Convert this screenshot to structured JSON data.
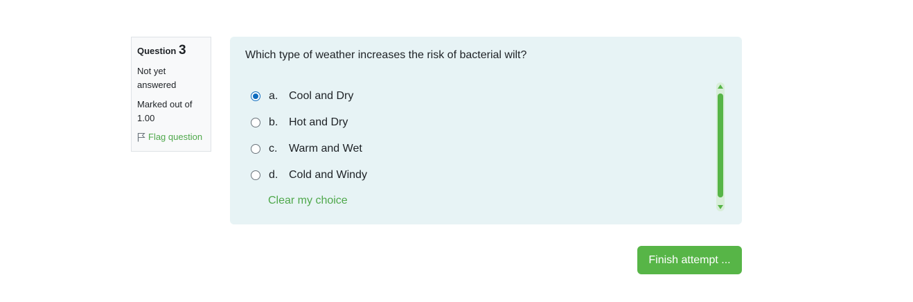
{
  "question_info": {
    "heading_label": "Question",
    "number": "3",
    "status": "Not yet answered",
    "marked_out_of": "Marked out of 1.00",
    "flag_label": "Flag question"
  },
  "question": {
    "text": "Which type of weather increases the risk of bacterial wilt?",
    "answers": [
      {
        "letter": "a.",
        "text": "Cool and Dry",
        "selected": true
      },
      {
        "letter": "b.",
        "text": "Hot and Dry",
        "selected": false
      },
      {
        "letter": "c.",
        "text": "Warm and Wet",
        "selected": false
      },
      {
        "letter": "d.",
        "text": "Cold and Windy",
        "selected": false
      }
    ],
    "clear_choice_label": "Clear my choice"
  },
  "finish_button_label": "Finish attempt ...",
  "colors": {
    "accent_green": "#57b547",
    "link_green": "#4fa84b",
    "radio_blue": "#0f6cbf",
    "content_bg": "#e7f3f5"
  },
  "icons": {
    "flag": "flag-icon",
    "radio": "radio-icon",
    "scroll_up": "chevron-up-icon",
    "scroll_down": "chevron-down-icon"
  }
}
